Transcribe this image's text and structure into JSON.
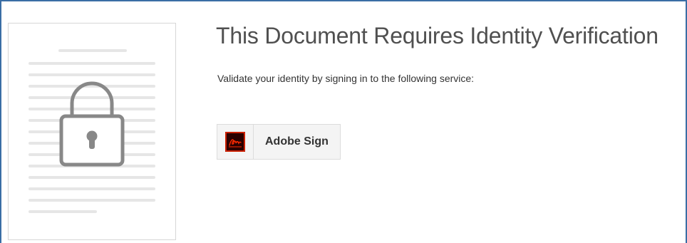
{
  "page": {
    "title": "This Document Requires Identity Verification",
    "instruction": "Validate your identity by signing in to the following service:"
  },
  "services": [
    {
      "label": "Adobe Sign",
      "icon": "adobe-sign-logo-icon"
    }
  ],
  "illustration": {
    "icon": "lock-icon"
  },
  "colors": {
    "frame_border": "#3a6ea5",
    "title_text": "#505050",
    "logo_background": "#2b0000",
    "logo_accent": "#ff2a00",
    "lock_stroke": "#888888"
  }
}
